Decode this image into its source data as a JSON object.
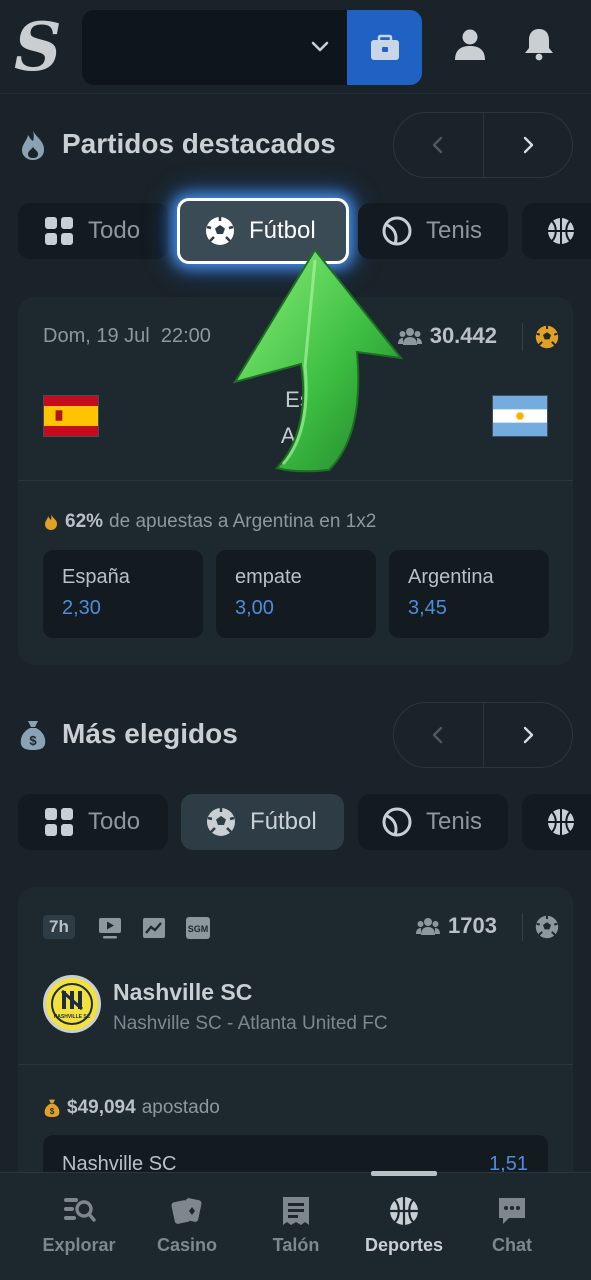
{
  "header": {
    "logo": "S",
    "icons": [
      "chevron-down-icon",
      "wallet-icon",
      "user-icon",
      "bell-icon"
    ]
  },
  "featured": {
    "title": "Partidos destacados",
    "chips": [
      "Todo",
      "Fútbol",
      "Tenis"
    ],
    "match": {
      "date": "Dom, 19 Jul",
      "time": "22:00",
      "fans": "30.442",
      "home_partial": "Es",
      "away_partial": "Arg",
      "hot_pct": "62%",
      "hot_text": "de apuestas a Argentina en 1x2",
      "odds": [
        {
          "label": "España",
          "value": "2,30"
        },
        {
          "label": "empate",
          "value": "3,00"
        },
        {
          "label": "Argentina",
          "value": "3,45"
        }
      ]
    }
  },
  "most": {
    "title": "Más elegidos",
    "chips": [
      "Todo",
      "Fútbol",
      "Tenis"
    ],
    "match": {
      "tag": "7h",
      "badge": "SGM",
      "fans": "1703",
      "logo_text": "NASHVILLE SC",
      "club": "Nashville SC",
      "subtitle": "Nashville SC - Atlanta United FC",
      "bet_amount": "$49,094",
      "bet_text": "apostado",
      "selection": {
        "name": "Nashville SC",
        "value": "1,51"
      }
    }
  },
  "nav": [
    {
      "label": "Explorar",
      "icon": "search-icon"
    },
    {
      "label": "Casino",
      "icon": "cards-icon"
    },
    {
      "label": "Talón",
      "icon": "ticket-icon"
    },
    {
      "label": "Deportes",
      "icon": "basketball-icon"
    },
    {
      "label": "Chat",
      "icon": "chat-icon"
    }
  ],
  "colors": {
    "accent": "#1f62c4",
    "odds": "#4f8ddb",
    "arrow": "#3ec043"
  }
}
